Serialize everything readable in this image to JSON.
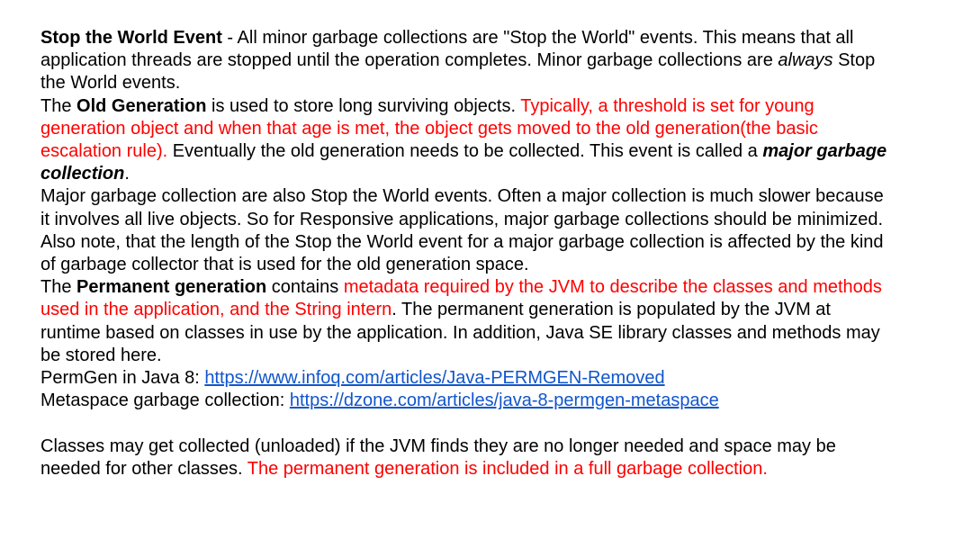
{
  "para1": {
    "term": "Stop the World Event",
    "text1": " - All minor garbage collections are \"Stop the World\" events. This means that all application threads are stopped until the operation completes. Minor garbage collections are ",
    "emphasis": "always",
    "text2": " Stop the World events."
  },
  "para2": {
    "text1": "The ",
    "term": "Old Generation",
    "text2": " is used to store long surviving objects. ",
    "highlight": "Typically, a threshold is set for young generation object and when that age is met, the object gets moved to the old generation(the basic escalation rule).",
    "text3": " Eventually the old generation needs to be collected. This event is called a ",
    "emphasis": "major garbage collection",
    "text4": "."
  },
  "para3": {
    "text": "Major garbage collection are also Stop the World events. Often a major collection is much slower because it involves all live objects. So for Responsive applications, major garbage collections should be minimized. Also note, that the length of the Stop the World event for a major garbage collection is affected by the kind of garbage collector that is used for the old generation space."
  },
  "para4": {
    "text1": "The ",
    "term": "Permanent generation",
    "text2": " contains ",
    "highlight": "metadata required by the JVM to describe the classes and methods used in the application, and the String intern",
    "text3": ". The permanent generation is populated by the JVM at runtime based on classes in use by the application. In addition, Java SE library classes and methods may be stored here."
  },
  "links": [
    {
      "label": "PermGen in Java 8: ",
      "url_text": "https://www.infoq.com/articles/Java-PERMGEN-Removed"
    },
    {
      "label": "Metaspace garbage collection: ",
      "url_text": "https://dzone.com/articles/java-8-permgen-metaspace"
    }
  ],
  "para5": {
    "text": "Classes may get collected (unloaded) if the JVM finds they are no longer needed and space may be needed for other classes. ",
    "highlight": "The permanent generation is included in a full garbage collection."
  },
  "colors": {
    "text": "#000000",
    "highlight": "#ff0000",
    "link": "#1155cc",
    "background": "#ffffff"
  }
}
